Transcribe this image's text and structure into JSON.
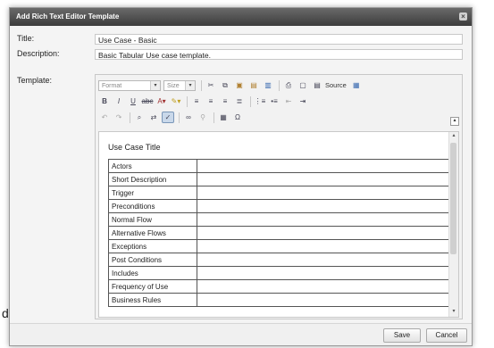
{
  "stray_char": "d",
  "dialog": {
    "title": "Add Rich Text Editor Template",
    "close_icon": "close-icon"
  },
  "form": {
    "title_label": "Title:",
    "title_value": "Use Case - Basic",
    "description_label": "Description:",
    "description_value": "Basic Tabular Use case template.",
    "template_label": "Template:"
  },
  "toolbar": {
    "format_label": "Format",
    "size_label": "Size",
    "source_label": "Source",
    "row1_icons": [
      "cut-icon",
      "copy-icon",
      "paste-icon",
      "paste-text-icon",
      "paste-word-icon",
      "print-icon",
      "preview-icon",
      "source-icon",
      "templates-icon"
    ],
    "row2_icons": [
      "bold-icon",
      "italic-icon",
      "underline-icon",
      "strikethrough-icon",
      "text-color-icon",
      "background-color-icon",
      "align-left-icon",
      "align-center-icon",
      "align-right-icon",
      "justify-icon",
      "numbered-list-icon",
      "bulleted-list-icon",
      "outdent-icon",
      "indent-icon"
    ],
    "row3_icons": [
      "undo-icon",
      "redo-icon",
      "find-icon",
      "replace-icon",
      "spellcheck-icon",
      "link-icon",
      "unlink-icon",
      "table-icon",
      "special-char-icon"
    ]
  },
  "document": {
    "heading": "Use Case Title",
    "rows": [
      "Actors",
      "Short Description",
      "Trigger",
      "Preconditions",
      "Normal Flow",
      "Alternative Flows",
      "Exceptions",
      "Post Conditions",
      "Includes",
      "Frequency of Use",
      "Business Rules"
    ]
  },
  "footer": {
    "save_label": "Save",
    "cancel_label": "Cancel"
  }
}
